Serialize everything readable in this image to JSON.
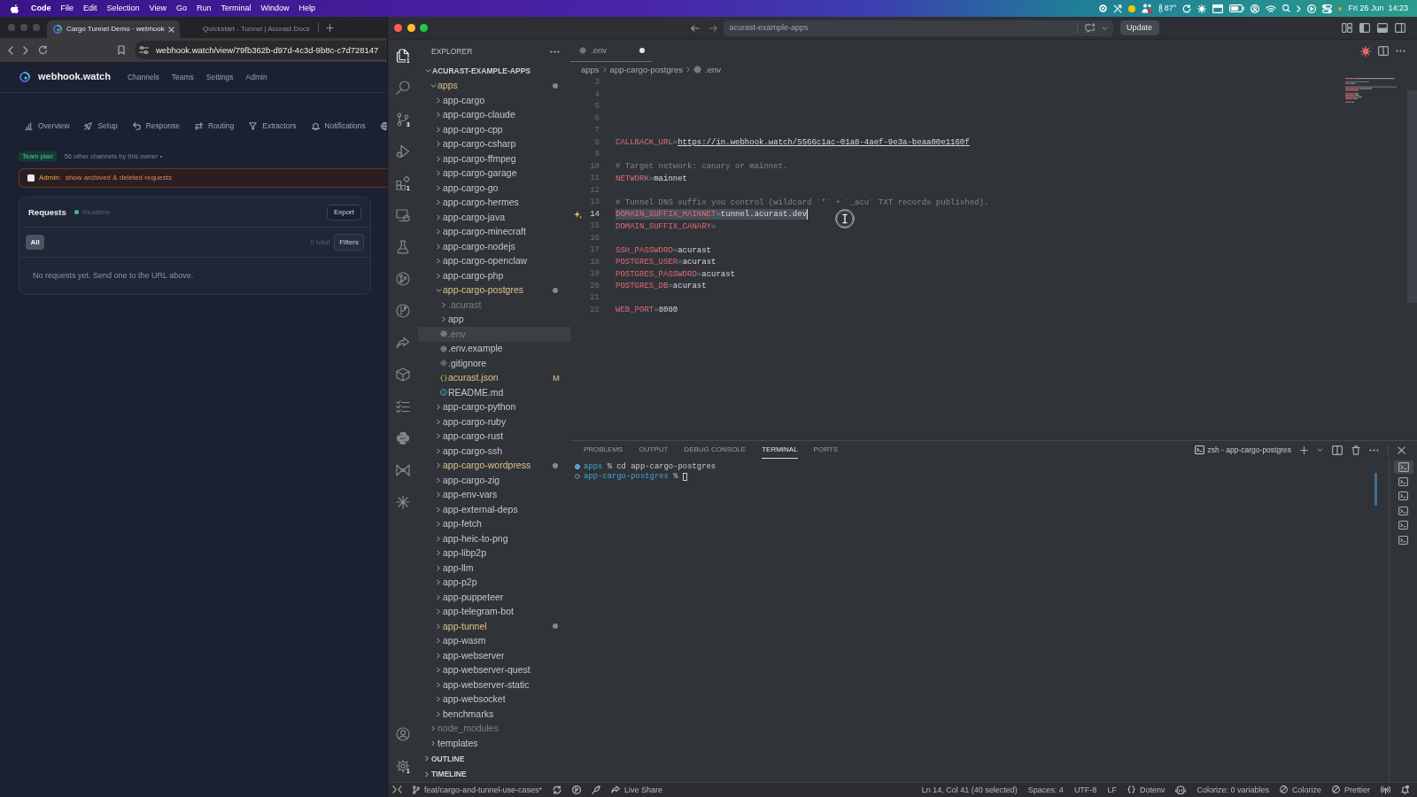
{
  "menu_bar": {
    "app_name": "Code",
    "menus": [
      "File",
      "Edit",
      "Selection",
      "View",
      "Go",
      "Run",
      "Terminal",
      "Window",
      "Help"
    ],
    "temperature": "87°",
    "date": "Fri 26 Jun",
    "time": "14:23"
  },
  "browser": {
    "tabs": [
      {
        "title": "Cargo Tunnel Demo · webhook",
        "selected": true
      },
      {
        "title": "Quickstart - Tunnel | Acurast Docs",
        "selected": false
      }
    ],
    "url": "webhook.watch/view/79fb362b-d97d-4c3d-9b8c-c7d728147",
    "page": {
      "brand": "webhook.watch",
      "nav": [
        "Channels",
        "Teams",
        "Settings",
        "Admin"
      ],
      "tabs": [
        "Overview",
        "Setup",
        "Response",
        "Routing",
        "Extractors",
        "Notifications"
      ],
      "plan_badge": "Team plan",
      "owner_note": "56 other channels by this owner •",
      "admin_banner": {
        "checked": false,
        "label": "Admin:",
        "text": "show archived & deleted requests"
      },
      "requests": {
        "title": "Requests",
        "live_status": "Realtime",
        "export_button": "Export",
        "filters": [
          {
            "label": "All",
            "selected": true
          }
        ],
        "count": "0 total",
        "filters_button": "Filters",
        "empty_message": "No requests yet. Send one to the URL above."
      }
    }
  },
  "vscode": {
    "title_bar": {
      "search": "acurast-example-apps",
      "update_button": "Update"
    },
    "activity_bar": [
      {
        "selected": true,
        "badge": "1"
      },
      {
        "selected": false
      },
      {
        "selected": false,
        "badge": "3"
      },
      {
        "selected": false
      },
      {
        "selected": false,
        "badge": "1"
      },
      {
        "selected": false
      },
      {
        "selected": false
      },
      {
        "selected": false
      },
      {
        "selected": false
      },
      {
        "selected": false
      },
      {
        "selected": false
      },
      {
        "selected": false
      },
      {
        "selected": false
      },
      {
        "selected": false
      },
      {
        "selected": false
      }
    ],
    "activity_bar_bottom": [
      {
        "selected": false
      },
      {
        "selected": false,
        "badge": "1"
      }
    ],
    "explorer": {
      "title": "EXPLORER",
      "tree": [
        {
          "label": "ACURAST-EXAMPLE-APPS",
          "kind": "root",
          "expanded": true,
          "selected": false,
          "modified": false,
          "ignored": false,
          "children": [
            {
              "label": "apps",
              "kind": "folder",
              "expanded": true,
              "selected": false,
              "modified": true,
              "ignored": false,
              "children": [
                {
                  "label": "app-cargo",
                  "kind": "folder",
                  "expanded": false,
                  "selected": false,
                  "modified": false,
                  "ignored": false
                },
                {
                  "label": "app-cargo-claude",
                  "kind": "folder",
                  "expanded": false,
                  "selected": false,
                  "modified": false,
                  "ignored": false
                },
                {
                  "label": "app-cargo-cpp",
                  "kind": "folder",
                  "expanded": false,
                  "selected": false,
                  "modified": false,
                  "ignored": false
                },
                {
                  "label": "app-cargo-csharp",
                  "kind": "folder",
                  "expanded": false,
                  "selected": false,
                  "modified": false,
                  "ignored": false
                },
                {
                  "label": "app-cargo-ffmpeg",
                  "kind": "folder",
                  "expanded": false,
                  "selected": false,
                  "modified": false,
                  "ignored": false
                },
                {
                  "label": "app-cargo-garage",
                  "kind": "folder",
                  "expanded": false,
                  "selected": false,
                  "modified": false,
                  "ignored": false
                },
                {
                  "label": "app-cargo-go",
                  "kind": "folder",
                  "expanded": false,
                  "selected": false,
                  "modified": false,
                  "ignored": false
                },
                {
                  "label": "app-cargo-hermes",
                  "kind": "folder",
                  "expanded": false,
                  "selected": false,
                  "modified": false,
                  "ignored": false
                },
                {
                  "label": "app-cargo-java",
                  "kind": "folder",
                  "expanded": false,
                  "selected": false,
                  "modified": false,
                  "ignored": false
                },
                {
                  "label": "app-cargo-minecraft",
                  "kind": "folder",
                  "expanded": false,
                  "selected": false,
                  "modified": false,
                  "ignored": false
                },
                {
                  "label": "app-cargo-nodejs",
                  "kind": "folder",
                  "expanded": false,
                  "selected": false,
                  "modified": false,
                  "ignored": false
                },
                {
                  "label": "app-cargo-openclaw",
                  "kind": "folder",
                  "expanded": false,
                  "selected": false,
                  "modified": false,
                  "ignored": false
                },
                {
                  "label": "app-cargo-php",
                  "kind": "folder",
                  "expanded": false,
                  "selected": false,
                  "modified": false,
                  "ignored": false
                },
                {
                  "label": "app-cargo-postgres",
                  "kind": "folder",
                  "expanded": true,
                  "selected": false,
                  "modified": true,
                  "ignored": false,
                  "children": [
                    {
                      "label": ".acurast",
                      "kind": "folder",
                      "expanded": false,
                      "selected": false,
                      "modified": false,
                      "ignored": true
                    },
                    {
                      "label": "app",
                      "kind": "folder",
                      "expanded": false,
                      "selected": false,
                      "modified": false,
                      "ignored": false
                    },
                    {
                      "label": ".env",
                      "kind": "env",
                      "selected": true,
                      "modified": false,
                      "ignored": true
                    },
                    {
                      "label": ".env.example",
                      "kind": "env",
                      "selected": false,
                      "modified": false,
                      "ignored": false
                    },
                    {
                      "label": ".gitignore",
                      "kind": "gitignore",
                      "selected": false,
                      "modified": false,
                      "ignored": false
                    },
                    {
                      "label": "acurast.json",
                      "kind": "json",
                      "selected": false,
                      "modified": true,
                      "ignored": false,
                      "badge": "M"
                    },
                    {
                      "label": "README.md",
                      "kind": "markdown",
                      "selected": false,
                      "modified": false,
                      "ignored": false
                    }
                  ]
                },
                {
                  "label": "app-cargo-python",
                  "kind": "folder",
                  "expanded": false,
                  "selected": false,
                  "modified": false,
                  "ignored": false
                },
                {
                  "label": "app-cargo-ruby",
                  "kind": "folder",
                  "expanded": false,
                  "selected": false,
                  "modified": false,
                  "ignored": false
                },
                {
                  "label": "app-cargo-rust",
                  "kind": "folder",
                  "expanded": false,
                  "selected": false,
                  "modified": false,
                  "ignored": false
                },
                {
                  "label": "app-cargo-ssh",
                  "kind": "folder",
                  "expanded": false,
                  "selected": false,
                  "modified": false,
                  "ignored": false
                },
                {
                  "label": "app-cargo-wordpress",
                  "kind": "folder",
                  "expanded": false,
                  "selected": false,
                  "modified": true,
                  "ignored": false
                },
                {
                  "label": "app-cargo-zig",
                  "kind": "folder",
                  "expanded": false,
                  "selected": false,
                  "modified": false,
                  "ignored": false
                },
                {
                  "label": "app-env-vars",
                  "kind": "folder",
                  "expanded": false,
                  "selected": false,
                  "modified": false,
                  "ignored": false
                },
                {
                  "label": "app-external-deps",
                  "kind": "folder",
                  "expanded": false,
                  "selected": false,
                  "modified": false,
                  "ignored": false
                },
                {
                  "label": "app-fetch",
                  "kind": "folder",
                  "expanded": false,
                  "selected": false,
                  "modified": false,
                  "ignored": false
                },
                {
                  "label": "app-heic-to-png",
                  "kind": "folder",
                  "expanded": false,
                  "selected": false,
                  "modified": false,
                  "ignored": false
                },
                {
                  "label": "app-libp2p",
                  "kind": "folder",
                  "expanded": false,
                  "selected": false,
                  "modified": false,
                  "ignored": false
                },
                {
                  "label": "app-llm",
                  "kind": "folder",
                  "expanded": false,
                  "selected": false,
                  "modified": false,
                  "ignored": false
                },
                {
                  "label": "app-p2p",
                  "kind": "folder",
                  "expanded": false,
                  "selected": false,
                  "modified": false,
                  "ignored": false
                },
                {
                  "label": "app-puppeteer",
                  "kind": "folder",
                  "expanded": false,
                  "selected": false,
                  "modified": false,
                  "ignored": false
                },
                {
                  "label": "app-telegram-bot",
                  "kind": "folder",
                  "expanded": false,
                  "selected": false,
                  "modified": false,
                  "ignored": false
                },
                {
                  "label": "app-tunnel",
                  "kind": "folder",
                  "expanded": false,
                  "selected": false,
                  "modified": true,
                  "ignored": false
                },
                {
                  "label": "app-wasm",
                  "kind": "folder",
                  "expanded": false,
                  "selected": false,
                  "modified": false,
                  "ignored": false
                },
                {
                  "label": "app-webserver",
                  "kind": "folder",
                  "expanded": false,
                  "selected": false,
                  "modified": false,
                  "ignored": false
                },
                {
                  "label": "app-webserver-quest",
                  "kind": "folder",
                  "expanded": false,
                  "selected": false,
                  "modified": false,
                  "ignored": false
                },
                {
                  "label": "app-webserver-static",
                  "kind": "folder",
                  "expanded": false,
                  "selected": false,
                  "modified": false,
                  "ignored": false
                },
                {
                  "label": "app-websocket",
                  "kind": "folder",
                  "expanded": false,
                  "selected": false,
                  "modified": false,
                  "ignored": false
                },
                {
                  "label": "benchmarks",
                  "kind": "folder",
                  "expanded": false,
                  "selected": false,
                  "modified": false,
                  "ignored": false
                }
              ]
            },
            {
              "label": "node_modules",
              "kind": "folder",
              "expanded": false,
              "selected": false,
              "modified": false,
              "ignored": true
            },
            {
              "label": "templates",
              "kind": "folder",
              "expanded": false,
              "selected": false,
              "modified": false,
              "ignored": false
            }
          ]
        }
      ],
      "sections": [
        {
          "label": "OUTLINE",
          "expanded": false
        },
        {
          "label": "TIMELINE",
          "expanded": false
        }
      ]
    },
    "editor": {
      "tabs": [
        {
          "label": ".env",
          "kind": "env",
          "selected": true,
          "modified": true
        }
      ],
      "breadcrumbs": [
        {
          "label": "apps",
          "kind": "folder"
        },
        {
          "label": "app-cargo-postgres",
          "kind": "folder"
        },
        {
          "label": ".env",
          "kind": "env"
        }
      ],
      "lines": [
        {
          "number": "3",
          "kind": "blank",
          "selected": false
        },
        {
          "number": "4",
          "kind": "blank",
          "selected": false
        },
        {
          "number": "5",
          "kind": "blank",
          "selected": false
        },
        {
          "number": "6",
          "kind": "blank",
          "selected": false
        },
        {
          "number": "7",
          "kind": "blank",
          "selected": false
        },
        {
          "number": "8",
          "kind": "entry",
          "text": "CALLBACK_URL=https://in.webhook.watch/5566c1ac-01a8-4aef-9e3a-beaa00e1160f",
          "link": true,
          "selected": false
        },
        {
          "number": "9",
          "kind": "blank",
          "selected": false
        },
        {
          "number": "10",
          "kind": "comment",
          "text": "# Target network: canary or mainnet.",
          "selected": false
        },
        {
          "number": "11",
          "kind": "entry",
          "text": "NETWORK=mainnet",
          "link": false,
          "selected": false
        },
        {
          "number": "12",
          "kind": "blank",
          "selected": false
        },
        {
          "number": "13",
          "kind": "comment",
          "text": "# Tunnel DNS suffix you control (wildcard `*` + `_acu` TXT records published).",
          "selected": false
        },
        {
          "number": "14",
          "kind": "entry",
          "text": "DOMAIN_SUFFIX_MAINNET=tunnel.acurast.dev",
          "link": false,
          "selected": true
        },
        {
          "number": "15",
          "kind": "entry",
          "text": "DOMAIN_SUFFIX_CANARY=",
          "selected": false
        },
        {
          "number": "16",
          "kind": "blank",
          "selected": false
        },
        {
          "number": "17",
          "kind": "entry",
          "text": "SSH_PASSWORD=acurast",
          "link": false,
          "selected": false
        },
        {
          "number": "18",
          "kind": "entry",
          "text": "POSTGRES_USER=acurast",
          "link": false,
          "selected": false
        },
        {
          "number": "19",
          "kind": "entry",
          "text": "POSTGRES_PASSWORD=acurast",
          "link": false,
          "selected": false
        },
        {
          "number": "20",
          "kind": "entry",
          "text": "POSTGRES_DB=acurast",
          "link": false,
          "selected": false
        },
        {
          "number": "21",
          "kind": "blank",
          "selected": false
        },
        {
          "number": "22",
          "kind": "entry",
          "text": "WEB_PORT=8080",
          "link": false,
          "selected": false
        }
      ]
    },
    "panel": {
      "tabs": [
        {
          "label": "PROBLEMS",
          "selected": false
        },
        {
          "label": "OUTPUT",
          "selected": false
        },
        {
          "label": "DEBUG CONSOLE",
          "selected": false
        },
        {
          "label": "TERMINAL",
          "selected": true
        },
        {
          "label": "PORTS",
          "selected": false
        }
      ],
      "terminal_name": "zsh - app-cargo-postgres",
      "terminal_lines": [
        {
          "kind": "done",
          "cwd": "apps",
          "prompt": "%",
          "command": "cd app-cargo-postgres",
          "cursor": false
        },
        {
          "kind": "running",
          "cwd": "app-cargo-postgres",
          "prompt": "%",
          "cursor": true
        }
      ],
      "terminals": [
        {
          "selected": true
        },
        {
          "selected": false
        },
        {
          "selected": false
        },
        {
          "selected": false
        },
        {
          "selected": false
        },
        {
          "selected": false
        }
      ]
    },
    "status_bar": {
      "branch": "feat/cargo-and-tunnel-use-cases*",
      "live_share": "Live Share",
      "items": [
        {
          "text": "Ln 14, Col 41 (40 selected)",
          "kind": "text"
        },
        {
          "text": "Spaces: 4",
          "kind": "text"
        },
        {
          "text": "UTF-8",
          "kind": "text"
        },
        {
          "text": "LF",
          "kind": "text"
        },
        {
          "text": "Dotenv",
          "kind": "language"
        },
        {
          "text": "Colorize: 0 variables",
          "kind": "text"
        },
        {
          "text": "Colorize",
          "kind": "blocked"
        },
        {
          "text": "Prettier",
          "kind": "blocked"
        }
      ]
    }
  }
}
